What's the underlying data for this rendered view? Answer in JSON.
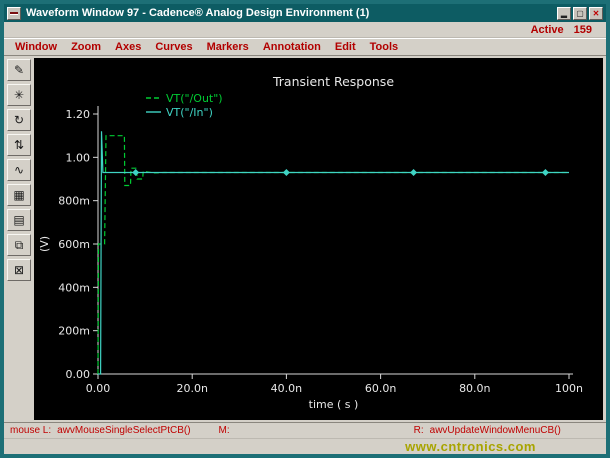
{
  "window": {
    "title": "Waveform Window 97 - Cadence® Analog Design Environment (1)",
    "controls": {
      "minimize": "▂",
      "maximize": "▢",
      "close": "✕"
    }
  },
  "header": {
    "active_label": "Active",
    "active_value": "159"
  },
  "menubar": {
    "items": [
      "Window",
      "Zoom",
      "Axes",
      "Curves",
      "Markers",
      "Annotation",
      "Edit",
      "Tools"
    ]
  },
  "toolbar": {
    "buttons": [
      {
        "name": "probe-tool",
        "glyph": "✎"
      },
      {
        "name": "zoom-fit-tool",
        "glyph": "✳"
      },
      {
        "name": "redraw-tool",
        "glyph": "↻"
      },
      {
        "name": "marker-tool",
        "glyph": "⇅"
      },
      {
        "name": "waveform-tool",
        "glyph": "∿"
      },
      {
        "name": "calculator-tool",
        "glyph": "▦"
      },
      {
        "name": "strip-mode-tool",
        "glyph": "▤"
      },
      {
        "name": "subwindow-tool",
        "glyph": "⧉"
      },
      {
        "name": "delete-tool",
        "glyph": "⊠"
      }
    ]
  },
  "statusbar": {
    "mouse_left_label": "mouse L:",
    "mouse_left_binding": "awvMouseSingleSelectPtCB()",
    "mouse_middle_label": "M:",
    "mouse_right_label": "R:",
    "mouse_right_binding": "awvUpdateWindowMenuCB()"
  },
  "watermark": "www.cntronics.com",
  "colors": {
    "titlebar": "#0d5c63",
    "frame": "#1d6f76",
    "menu_text": "#b20000",
    "status_text": "#c00000",
    "watermark": "#a8a400",
    "plot_bg": "#000000",
    "axis": "#d9d9d9"
  },
  "chart_data": {
    "type": "line",
    "title": "Transient Response",
    "xlabel": "time ( s )",
    "ylabel": "(V)",
    "x_unit": "ns",
    "xlim": [
      0,
      100
    ],
    "ylim": [
      0,
      1.2
    ],
    "x_ticks": [
      {
        "v": 0,
        "label": "0.00"
      },
      {
        "v": 20,
        "label": "20.0n"
      },
      {
        "v": 40,
        "label": "40.0n"
      },
      {
        "v": 60,
        "label": "60.0n"
      },
      {
        "v": 80,
        "label": "80.0n"
      },
      {
        "v": 100,
        "label": "100n"
      }
    ],
    "y_ticks": [
      {
        "v": 0,
        "label": "0.00"
      },
      {
        "v": 0.2,
        "label": "200m"
      },
      {
        "v": 0.4,
        "label": "400m"
      },
      {
        "v": 0.6,
        "label": "600m"
      },
      {
        "v": 0.8,
        "label": "800m"
      },
      {
        "v": 1.0,
        "label": "1.00"
      },
      {
        "v": 1.2,
        "label": "1.20"
      }
    ],
    "legend": [
      {
        "label": "VT(\"/Out\")",
        "color": "#00cc33",
        "dash": "5 3"
      },
      {
        "label": "VT(\"/In\")",
        "color": "#3fd4c4",
        "dash": ""
      }
    ],
    "series": [
      {
        "name": "VT(\"/Out\")",
        "color": "#00cc33",
        "dash": "5 3",
        "points": [
          [
            0,
            0
          ],
          [
            0.1,
            0.6
          ],
          [
            1.4,
            0.6
          ],
          [
            1.7,
            1.1
          ],
          [
            5.6,
            1.1
          ],
          [
            5.7,
            0.87
          ],
          [
            6.9,
            0.87
          ],
          [
            7.0,
            0.95
          ],
          [
            8.2,
            0.95
          ],
          [
            8.3,
            0.9
          ],
          [
            9.5,
            0.9
          ],
          [
            9.6,
            0.935
          ],
          [
            12,
            0.928
          ],
          [
            14,
            0.93
          ],
          [
            100,
            0.93
          ]
        ]
      },
      {
        "name": "VT(\"/In\")",
        "color": "#3fd4c4",
        "dash": "",
        "points": [
          [
            0,
            0
          ],
          [
            0.55,
            0
          ],
          [
            0.75,
            1.12
          ],
          [
            1.05,
            0.93
          ],
          [
            100,
            0.93
          ]
        ],
        "markers_x": [
          8,
          40,
          67,
          95
        ],
        "marker_y": 0.93
      }
    ]
  }
}
